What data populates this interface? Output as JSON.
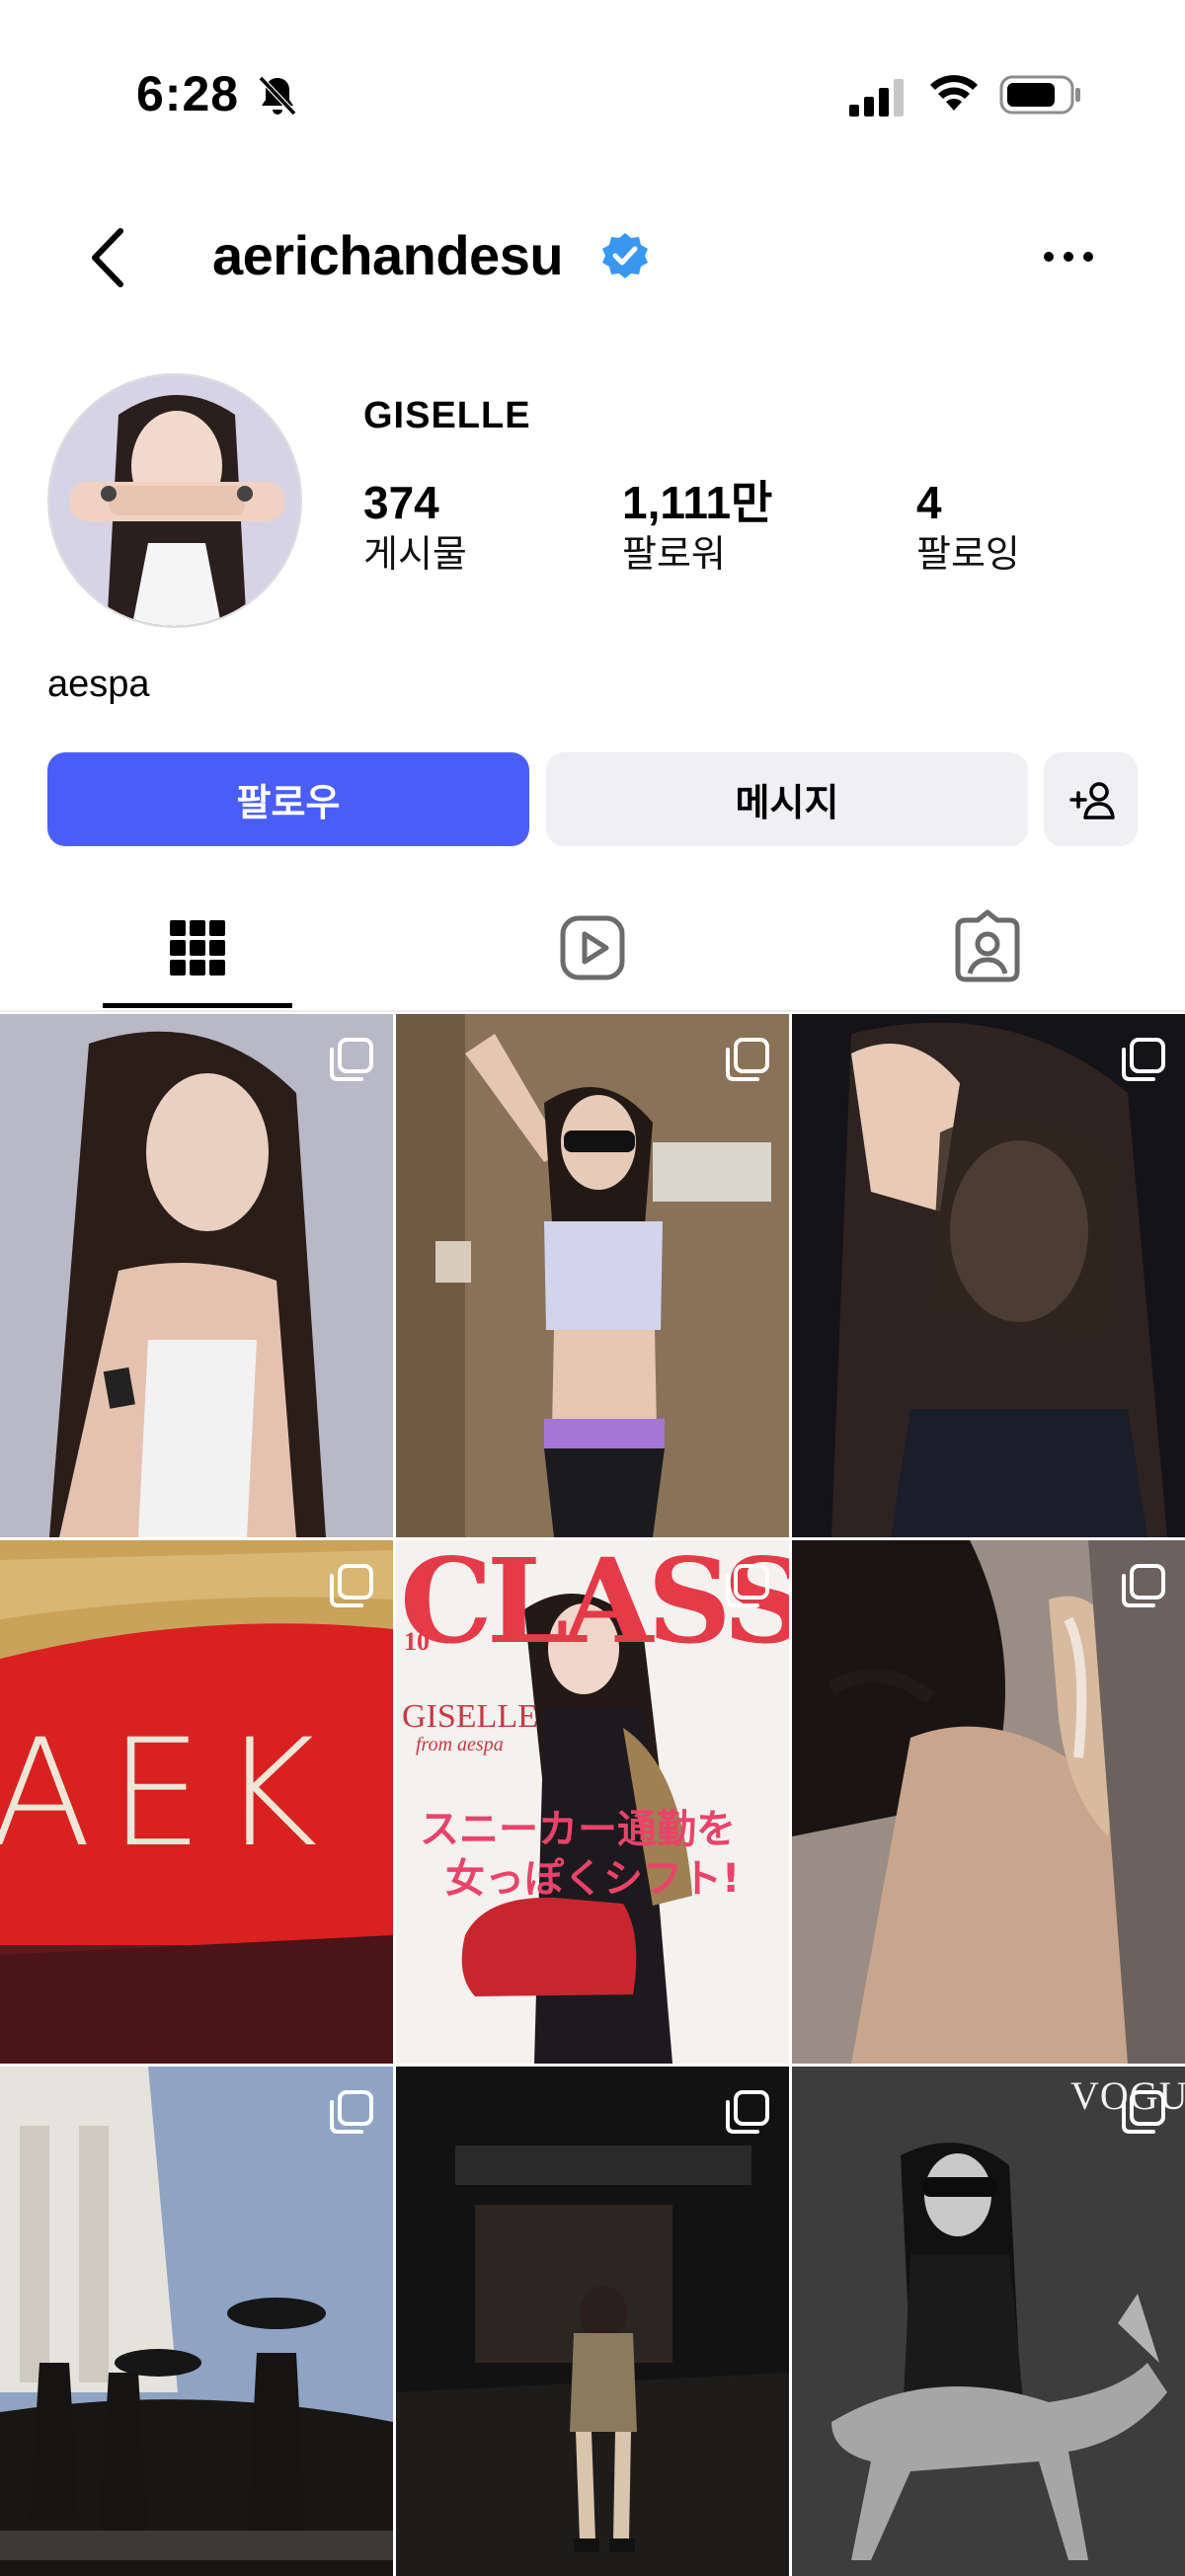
{
  "status_bar": {
    "time": "6:28",
    "silent_mode": true,
    "signal_bars": 3,
    "wifi": true,
    "battery_level": 0.7
  },
  "header": {
    "username": "aerichandesu",
    "verified": true,
    "back_icon": "chevron-left-icon",
    "more_icon": "more-horizontal-icon"
  },
  "profile": {
    "display_name": "GISELLE",
    "stats": {
      "posts": {
        "value": "374",
        "label": "게시물"
      },
      "followers": {
        "value": "1,111만",
        "label": "팔로워"
      },
      "following": {
        "value": "4",
        "label": "팔로잉"
      }
    },
    "bio": "aespa"
  },
  "actions": {
    "follow_label": "팔로우",
    "message_label": "메시지",
    "add_user_icon": "add-user-icon",
    "accent_color": "#4a5df9"
  },
  "tabs": [
    {
      "name": "posts",
      "icon": "grid-icon",
      "active": true
    },
    {
      "name": "reels",
      "icon": "reels-icon",
      "active": false
    },
    {
      "name": "tagged",
      "icon": "tagged-icon",
      "active": false
    }
  ],
  "grid": {
    "posts": [
      {
        "id": "post-1",
        "multi": true
      },
      {
        "id": "post-2",
        "multi": true
      },
      {
        "id": "post-3",
        "multi": true
      },
      {
        "id": "post-4",
        "multi": true,
        "text": "AEK"
      },
      {
        "id": "post-5",
        "multi": true,
        "magazine_title": "CLASSY.",
        "issue_number": "10",
        "cover_name": "GISELLE",
        "cover_sub": "from aespa",
        "headline_1": "スニーカー通勤を",
        "headline_2": "女っぽくシフト!"
      },
      {
        "id": "post-6",
        "multi": true
      },
      {
        "id": "post-7",
        "multi": true
      },
      {
        "id": "post-8",
        "multi": true
      },
      {
        "id": "post-9",
        "multi": true,
        "magazine_title": "VOGUE"
      }
    ]
  }
}
